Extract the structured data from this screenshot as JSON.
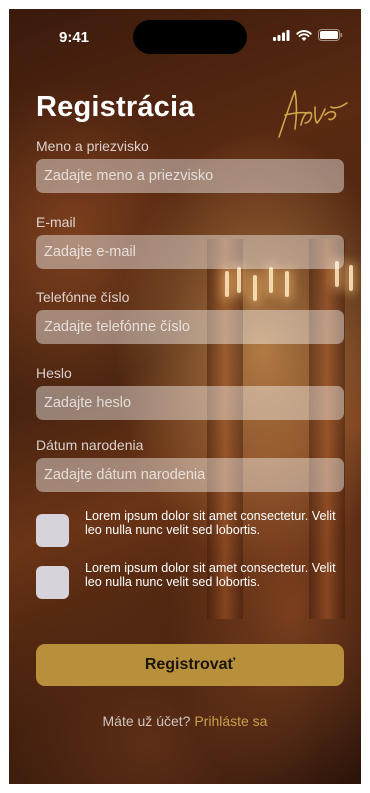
{
  "status_bar": {
    "time": "9:41"
  },
  "form": {
    "title": "Registrácia",
    "fields": [
      {
        "label": "Meno a priezvisko",
        "placeholder": "Zadajte meno a priezvisko"
      },
      {
        "label": "E-mail",
        "placeholder": "Zadajte e-mail"
      },
      {
        "label": "Telefónne číslo",
        "placeholder": "Zadajte telefónne číslo"
      },
      {
        "label": "Heslo",
        "placeholder": "Zadajte heslo"
      },
      {
        "label": "Dátum narodenia",
        "placeholder": "Zadajte dátum narodenia"
      }
    ],
    "checkboxes": [
      {
        "text": "Lorem ipsum dolor sit amet consectetur. Velit leo nulla nunc velit sed lobortis."
      },
      {
        "text": "Lorem ipsum dolor sit amet consectetur. Velit leo nulla nunc velit sed lobortis."
      }
    ],
    "register_label": "Registrovať",
    "login_prompt": "Máte už účet?",
    "login_link": "Prihláste sa"
  },
  "colors": {
    "accent": "#b8903c",
    "link": "#c9a04a",
    "checkbox": "#d6d3db"
  }
}
